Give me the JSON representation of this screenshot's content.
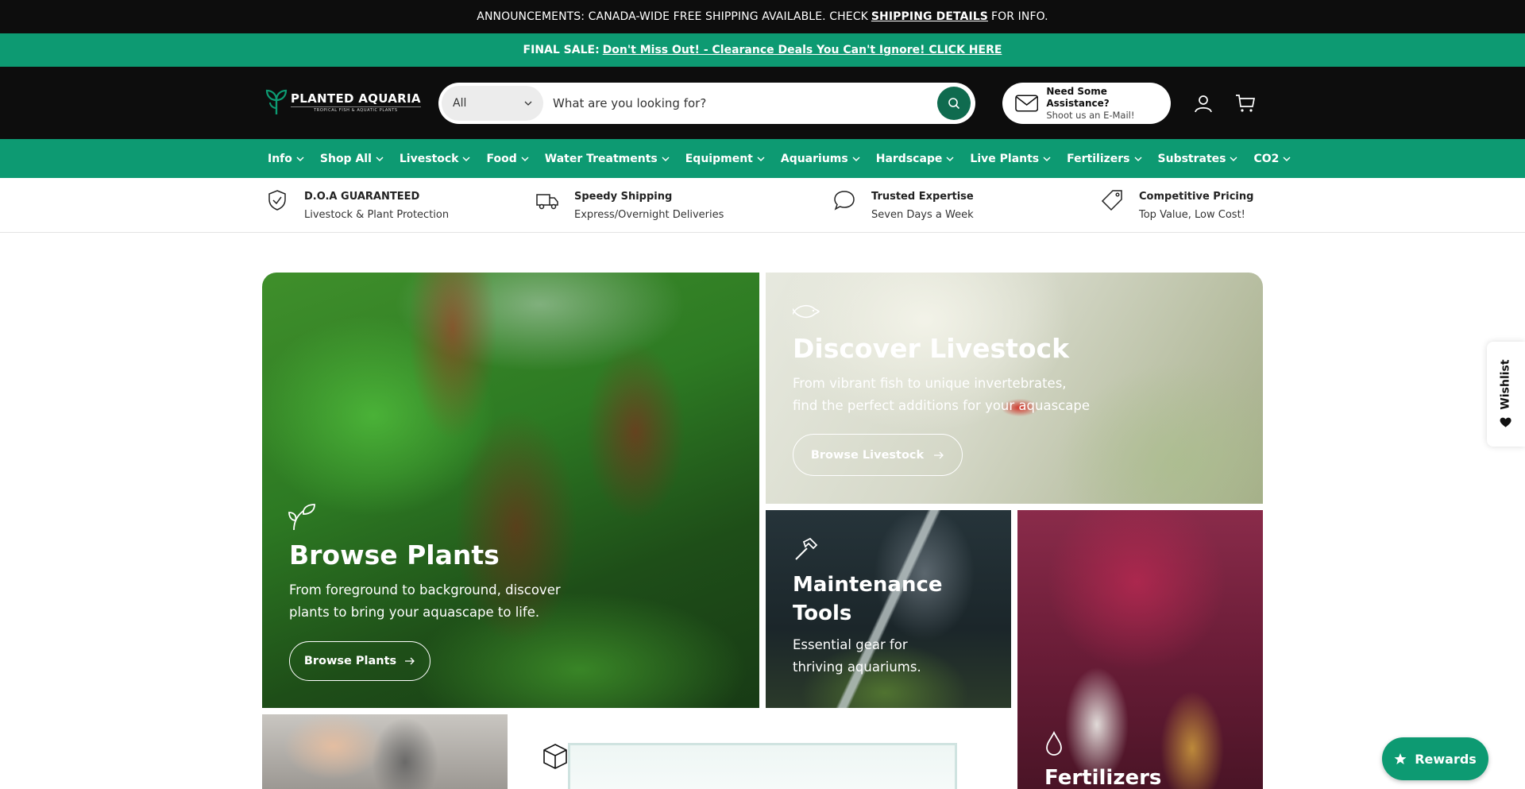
{
  "announcement": {
    "prefix": "ANNOUNCEMENTS: CANADA-WIDE FREE SHIPPING AVAILABLE. CHECK",
    "link": "SHIPPING DETAILS",
    "suffix": "FOR INFO."
  },
  "sale_bar": {
    "prefix": "FINAL SALE:",
    "link": "Don't Miss Out! - Clearance Deals You Can't Ignore! CLICK HERE"
  },
  "header": {
    "logo_title": "PLANTED AQUARIA",
    "logo_tagline": "TROPICAL FISH & AQUATIC PLANTS",
    "search": {
      "category": "All",
      "placeholder": "What are you looking for?"
    },
    "assist": {
      "title": "Need Some Assistance?",
      "subtitle": "Shoot us an E-Mail!"
    }
  },
  "nav": {
    "items": [
      "Info",
      "Shop All",
      "Livestock",
      "Food",
      "Water Treatments",
      "Equipment",
      "Aquariums",
      "Hardscape",
      "Live Plants",
      "Fertilizers",
      "Substrates",
      "CO2"
    ]
  },
  "usps": [
    {
      "title": "D.O.A GUARANTEED",
      "subtitle": "Livestock & Plant Protection",
      "icon": "shield-check-icon"
    },
    {
      "title": "Speedy Shipping",
      "subtitle": "Express/Overnight Deliveries",
      "icon": "truck-icon"
    },
    {
      "title": "Trusted Expertise",
      "subtitle": "Seven Days a Week",
      "icon": "chat-bubble-icon"
    },
    {
      "title": "Competitive Pricing",
      "subtitle": "Top Value, Low Cost!",
      "icon": "price-tag-icon"
    }
  ],
  "tiles": {
    "plants": {
      "title": "Browse Plants",
      "desc_line1": "From foreground to background, discover",
      "desc_line2": "plants to bring your aquascape to life.",
      "button": "Browse Plants"
    },
    "livestock": {
      "title": "Discover Livestock",
      "desc_line1": "From vibrant fish to unique invertebrates,",
      "desc_line2": "find the perfect additions for your aquascape",
      "button": "Browse Livestock"
    },
    "tools": {
      "title_line1": "Maintenance",
      "title_line2": "Tools",
      "desc_line1": "Essential gear for",
      "desc_line2": "thriving aquariums."
    },
    "fertilizers": {
      "title": "Fertilizers"
    }
  },
  "wishlist_label": "Wishlist",
  "rewards_label": "Rewards",
  "colors": {
    "brand_green": "#0d9a72",
    "dark_green": "#0f6b4f",
    "header_black": "#0d0d0d"
  }
}
